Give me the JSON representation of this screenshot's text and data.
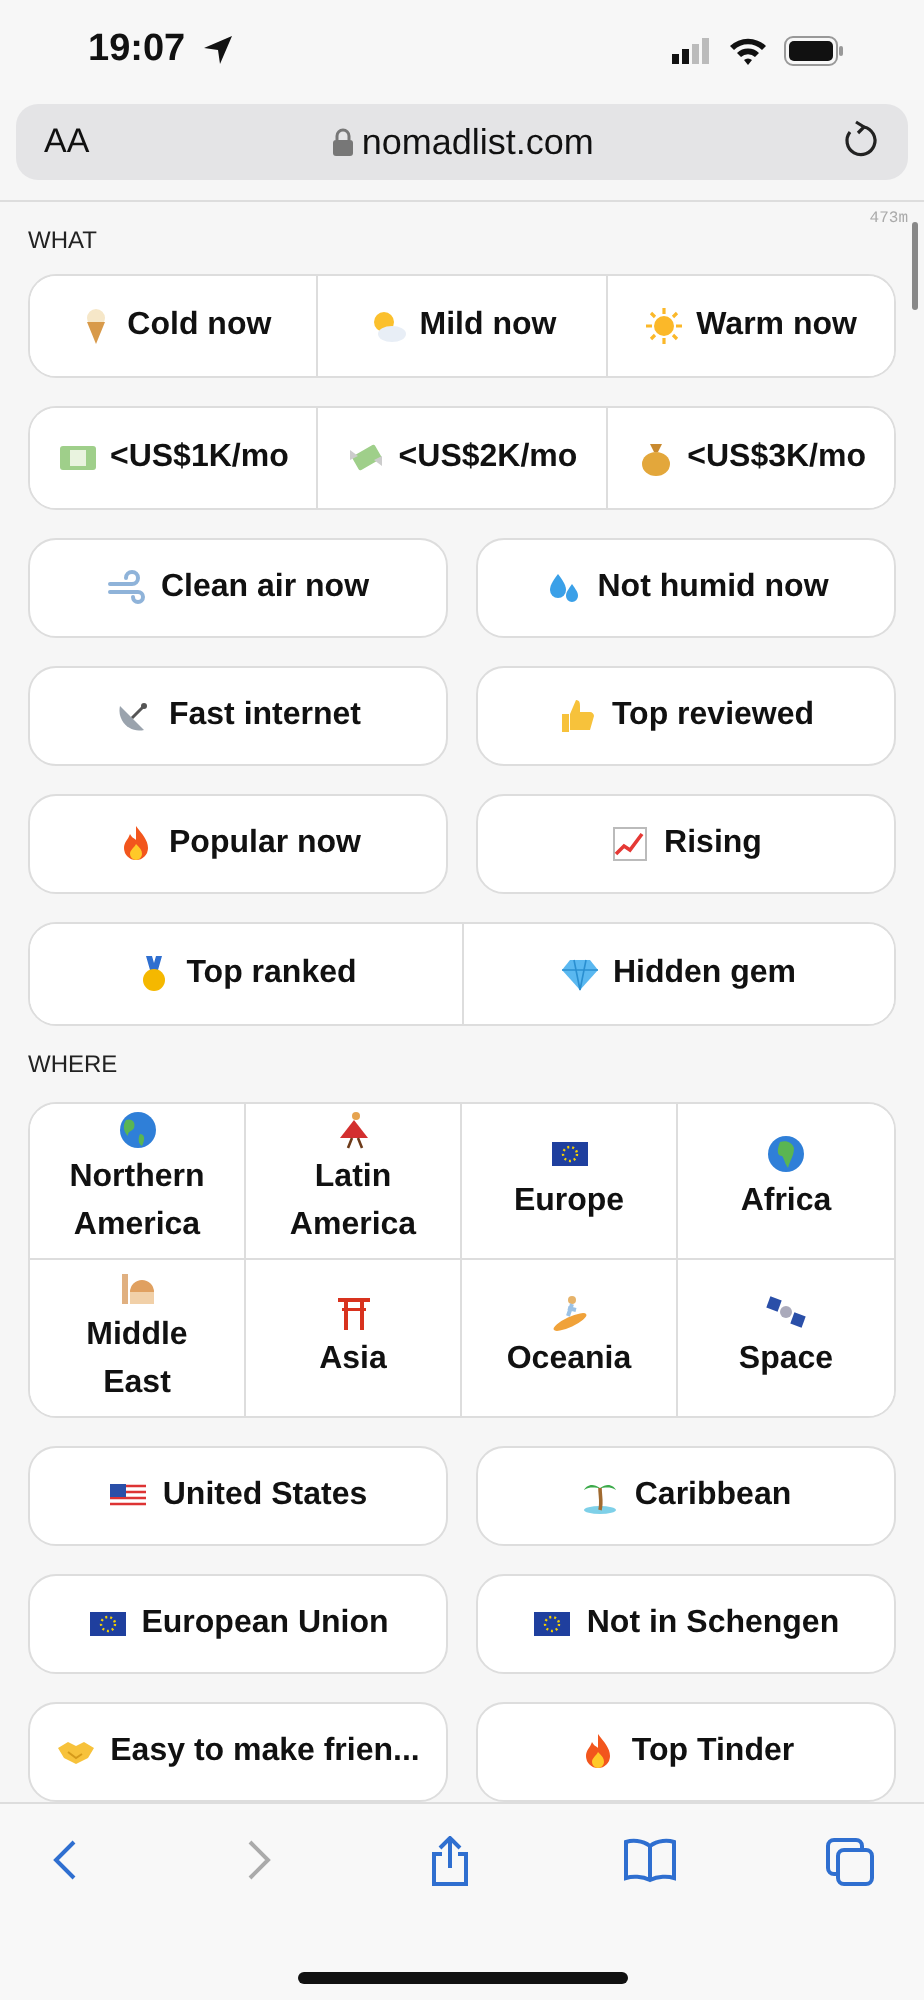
{
  "status_bar": {
    "time": "19:07"
  },
  "address_bar": {
    "text_size": "AA",
    "url": "nomadlist.com"
  },
  "load_time": "473m",
  "sections": [
    {
      "heading": "WHAT",
      "rows": [
        {
          "kind": "joined",
          "buttons": [
            "Cold now",
            "Mild now",
            "Warm now"
          ]
        },
        {
          "kind": "joined",
          "buttons": [
            "<US$1K/mo",
            "<US$2K/mo",
            "<US$3K/mo"
          ]
        },
        {
          "kind": "split",
          "buttons": [
            "Clean air now",
            "Not humid now"
          ]
        },
        {
          "kind": "split",
          "buttons": [
            "Fast internet",
            "Top reviewed"
          ]
        },
        {
          "kind": "split",
          "buttons": [
            "Popular now",
            "Rising"
          ]
        },
        {
          "kind": "joined",
          "buttons": [
            "Top ranked",
            "Hidden gem"
          ]
        }
      ]
    },
    {
      "heading": "WHERE",
      "rows": [
        {
          "kind": "grid",
          "buttons": [
            "Northern America",
            "Latin America",
            "Europe",
            "Africa",
            "Middle East",
            "Asia",
            "Oceania",
            "Space"
          ]
        },
        {
          "kind": "split",
          "buttons": [
            "United States",
            "Caribbean"
          ]
        },
        {
          "kind": "split",
          "buttons": [
            "European Union",
            "Not in Schengen"
          ]
        },
        {
          "kind": "split",
          "buttons": [
            "Easy to make frien...",
            "Top Tinder"
          ]
        }
      ]
    }
  ],
  "toolbar": {
    "back_disabled": false,
    "forward_disabled": true
  }
}
